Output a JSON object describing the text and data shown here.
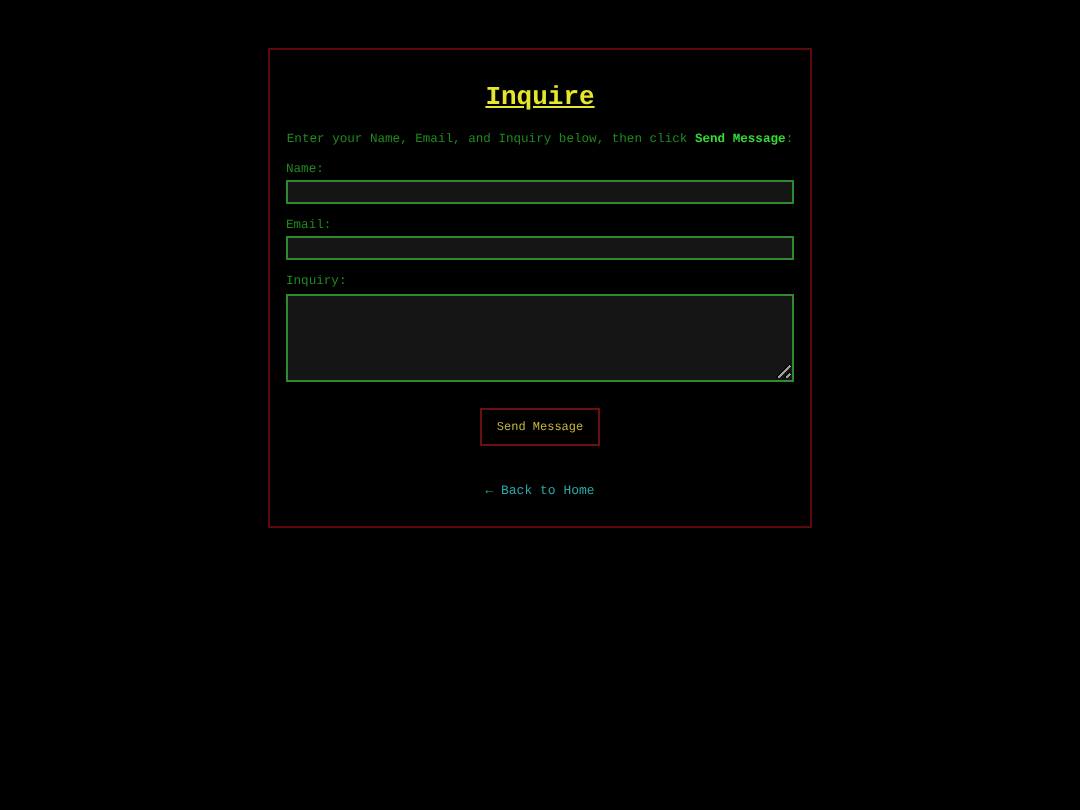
{
  "title": "Inquire",
  "intro": "Enter your Name, Email, and Inquiry below, then click **Send Message**:",
  "fields": [
    {
      "label": "Name:",
      "kind": "input"
    },
    {
      "label": "Email:",
      "kind": "input"
    },
    {
      "label": "Inquiry:",
      "kind": "textarea"
    }
  ],
  "submit": "Send Message",
  "back_link": "← Back to Home"
}
